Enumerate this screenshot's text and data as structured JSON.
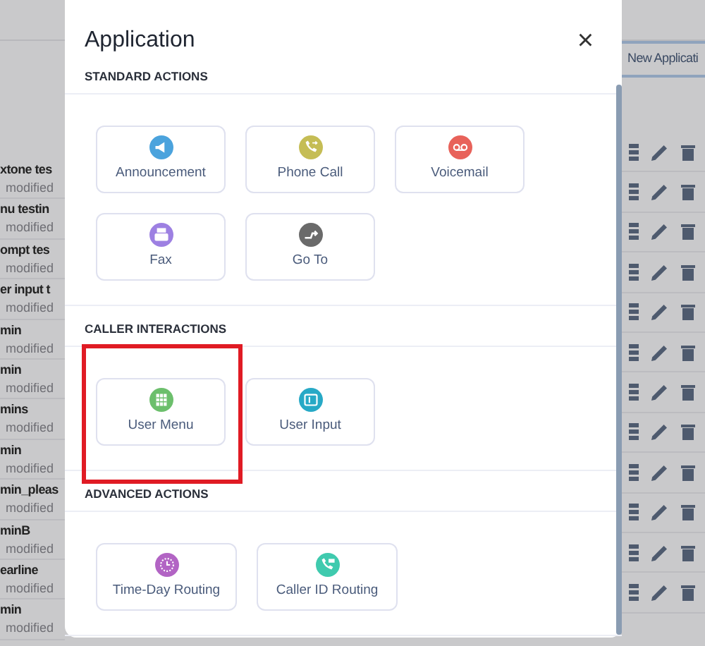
{
  "background": {
    "new_button": "New Applicati",
    "rows": [
      {
        "title": "xtone tes",
        "meta": "modified"
      },
      {
        "title": "nu testin",
        "meta": "modified"
      },
      {
        "title": "ompt tes",
        "meta": "modified"
      },
      {
        "title": "er input t",
        "meta": "modified"
      },
      {
        "title": "min",
        "meta": "modified"
      },
      {
        "title": "min",
        "meta": "modified"
      },
      {
        "title": "mins",
        "meta": "modified"
      },
      {
        "title": "min",
        "meta": "modified"
      },
      {
        "title": "min_pleas",
        "meta": "modified"
      },
      {
        "title": "minB",
        "meta": "modified"
      },
      {
        "title": "earline",
        "meta": "modified"
      },
      {
        "title": "min",
        "meta": "modified"
      }
    ]
  },
  "modal": {
    "title": "Application",
    "close": "×",
    "sections": [
      {
        "heading": "STANDARD ACTIONS",
        "actions": [
          {
            "label": "Announcement",
            "kind": "megaphone",
            "color": "#4ba3dd",
            "highlighted": false
          },
          {
            "label": "Phone Call",
            "kind": "phone-forward",
            "color": "#c5bd55",
            "highlighted": false
          },
          {
            "label": "Voicemail",
            "kind": "voicemail",
            "color": "#e8625a",
            "highlighted": false
          },
          {
            "label": "Fax",
            "kind": "fax",
            "color": "#9d80e2",
            "highlighted": false
          },
          {
            "label": "Go To",
            "kind": "goto",
            "color": "#6a6a6a",
            "highlighted": false
          }
        ]
      },
      {
        "heading": "CALLER INTERACTIONS",
        "actions": [
          {
            "label": "User Menu",
            "kind": "grid",
            "color": "#6cbf6c",
            "highlighted": true
          },
          {
            "label": "User Input",
            "kind": "input",
            "color": "#27a9c6",
            "highlighted": false
          }
        ]
      },
      {
        "heading": "ADVANCED ACTIONS",
        "actions": [
          {
            "label": "Time-Day Routing",
            "kind": "clock",
            "color": "#b264c4",
            "highlighted": false
          },
          {
            "label": "Caller ID Routing",
            "kind": "phone-id",
            "color": "#3fcaae",
            "highlighted": false
          }
        ]
      }
    ]
  }
}
